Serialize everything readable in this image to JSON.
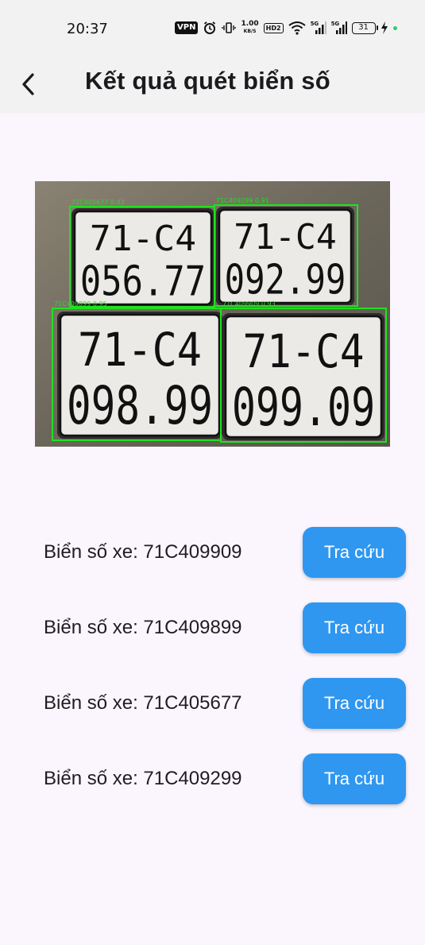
{
  "status_bar": {
    "time": "20:37",
    "vpn": "VPN",
    "net_speed_value": "1.00",
    "net_speed_unit": "KB/S",
    "hd_badge": "HD2",
    "sim1_label": "5G",
    "sim2_label": "5G",
    "battery_level": "31",
    "icons": [
      "vpn-icon",
      "alarm-icon",
      "vibrate-icon",
      "hd-voice-icon",
      "wifi-icon",
      "signal-icon",
      "signal-icon",
      "battery-icon",
      "charging-icon"
    ]
  },
  "app_bar": {
    "title": "Kết quả quét biển số",
    "back_icon": "chevron-left-icon"
  },
  "scan_image": {
    "plates": [
      {
        "line1": "71",
        "sep": "-",
        "line1b": "C4",
        "line2": "056.77",
        "detection_label": "71C405677 0.93"
      },
      {
        "line1": "71",
        "sep": "-",
        "line1b": "C4",
        "line2": "092.99",
        "detection_label": "71C409299 0.91"
      },
      {
        "line1": "71",
        "sep": "-",
        "line1b": "C4",
        "line2": "098.99",
        "detection_label": "71C409899 0.95"
      },
      {
        "line1": "71",
        "sep": "-",
        "line1b": "C4",
        "line2": "099.09",
        "detection_label": "71C409909 0.93"
      }
    ],
    "box_color": "#21e021"
  },
  "results": [
    {
      "label": "Biển số xe: 71C409909",
      "button": "Tra cứu"
    },
    {
      "label": "Biển số xe: 71C409899",
      "button": "Tra cứu"
    },
    {
      "label": "Biển số xe: 71C405677",
      "button": "Tra cứu"
    },
    {
      "label": "Biển số xe: 71C409299",
      "button": "Tra cứu"
    }
  ],
  "colors": {
    "accent": "#2f97f0",
    "background": "#fbf5fd",
    "appbar": "#f2f2f2"
  }
}
